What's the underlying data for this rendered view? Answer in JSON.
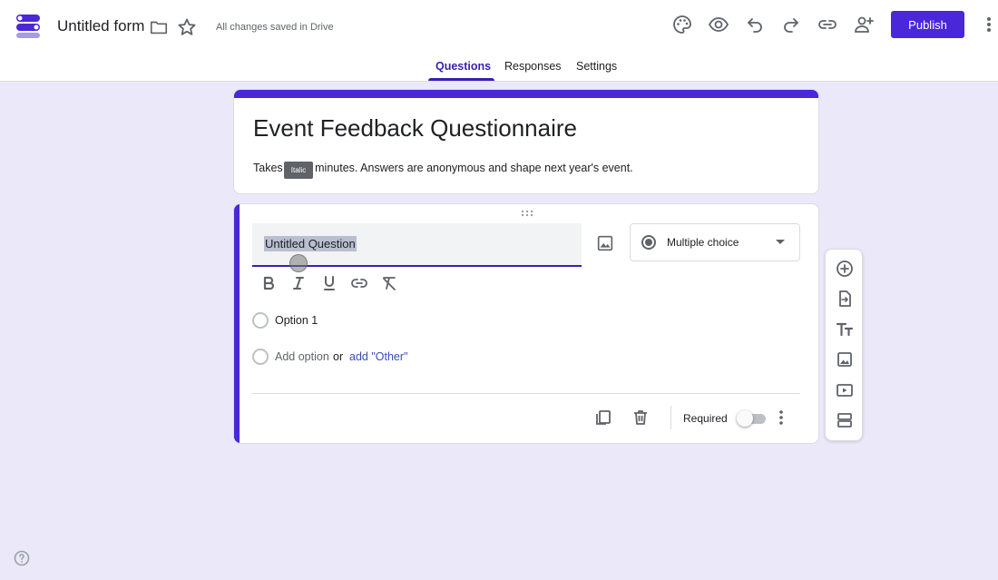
{
  "header": {
    "title": "Untitled form",
    "saved_status": "All changes saved in Drive",
    "publish_label": "Publish",
    "icons": [
      "palette-icon",
      "preview-icon",
      "undo-icon",
      "redo-icon",
      "link-icon",
      "add-collaborator-icon",
      "more-vert-icon"
    ]
  },
  "tabs": [
    {
      "label": "Questions",
      "active": true
    },
    {
      "label": "Responses",
      "active": false
    },
    {
      "label": "Settings",
      "active": false
    }
  ],
  "form": {
    "title": "Event Feedback Questionnaire",
    "description": "Takes 2 minutes. Answers are anonymous and shape next year's event.",
    "description_prefix": "Takes ",
    "description_suffix": "minutes. Answers are anonymous and shape next year's event.",
    "tooltip": "Italic"
  },
  "question": {
    "title": "Untitled Question",
    "type": "Multiple choice",
    "options": [
      "Option 1"
    ],
    "add_option_label": "Add option",
    "or_label": "or",
    "add_other_label": "add \"Other\"",
    "required_label": "Required",
    "required": false
  },
  "colors": {
    "accent": "#4a27d8",
    "background": "#ebe9f9",
    "tab_active": "#3a1fb0"
  }
}
